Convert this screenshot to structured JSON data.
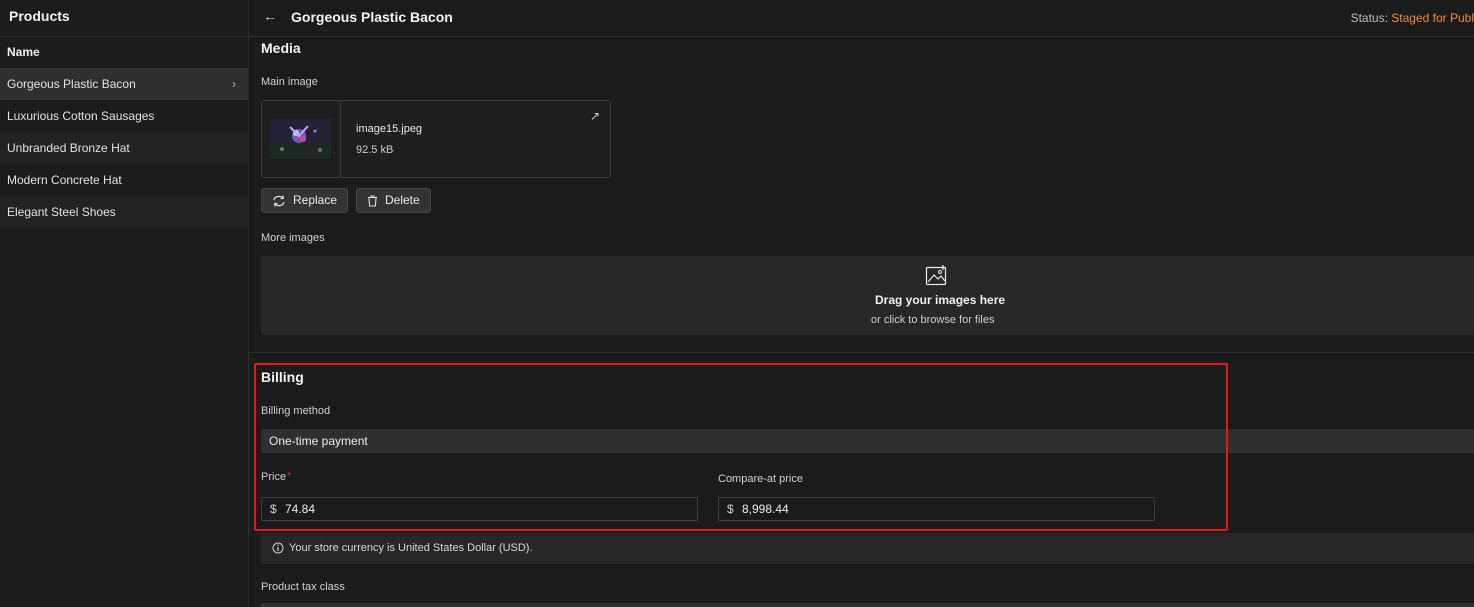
{
  "sidebar": {
    "title": "Products",
    "column_header": "Name",
    "items": [
      {
        "label": "Gorgeous Plastic Bacon"
      },
      {
        "label": "Luxurious Cotton Sausages"
      },
      {
        "label": "Unbranded Bronze Hat"
      },
      {
        "label": "Modern Concrete Hat"
      },
      {
        "label": "Elegant Steel Shoes"
      }
    ],
    "active_chevron": "›"
  },
  "header": {
    "back_icon": "←",
    "title": "Gorgeous Plastic Bacon",
    "status_label": "Status:",
    "status_value": "Staged for Publ",
    "status_color": "#f08a3c"
  },
  "media": {
    "title": "Media",
    "main_image_label": "Main image",
    "file_name": "image15.jpeg",
    "file_size": "92.5 kB",
    "open_icon": "↗",
    "replace_label": "Replace",
    "delete_label": "Delete",
    "more_images_label": "More images",
    "dropzone_title": "Drag your images here",
    "dropzone_subtitle": "or click to browse for files"
  },
  "billing": {
    "title": "Billing",
    "method_label": "Billing method",
    "method_value": "One-time payment",
    "price_label": "Price",
    "required_mark": "*",
    "price_currency": "$",
    "price_value": "74.84",
    "compare_label": "Compare-at price",
    "compare_currency": "$",
    "compare_value": "8,998.44",
    "highlight_color": "#e01b1b"
  },
  "currency_note": "Your store currency is United States Dollar (USD).",
  "tax_class_label": "Product tax class"
}
